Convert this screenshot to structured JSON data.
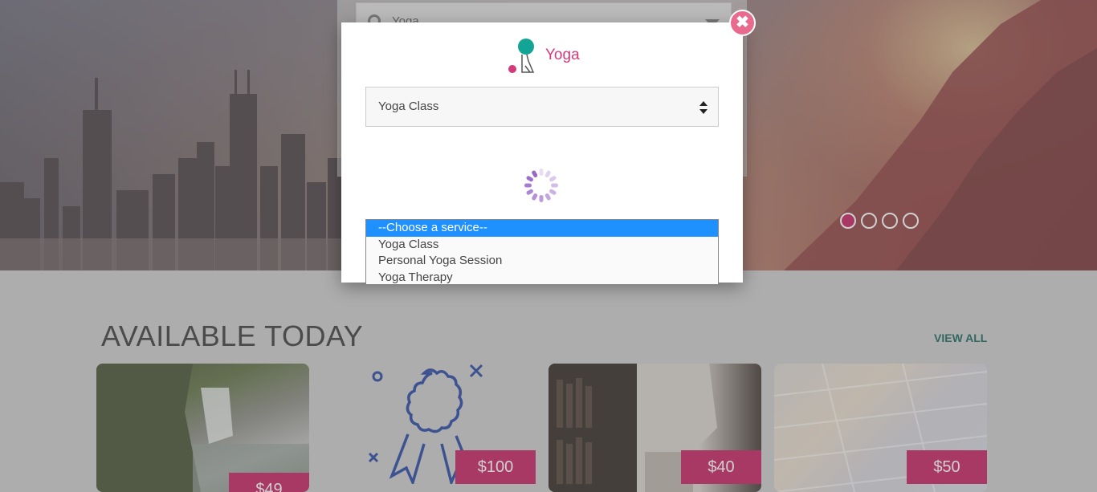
{
  "hero": {
    "search_value": "Yoga",
    "carousel_count": 4,
    "carousel_active": 1
  },
  "section": {
    "title": "AVAILABLE TODAY",
    "view_all": "VIEW ALL"
  },
  "cards": [
    {
      "price": "$49"
    },
    {
      "price": "$100"
    },
    {
      "price": "$40"
    },
    {
      "price": "$50"
    }
  ],
  "modal": {
    "title": "Yoga",
    "selected_class": "Yoga Class",
    "close_icon": "close-icon",
    "service_options": [
      "--Choose a service--",
      "Yoga Class",
      "Personal Yoga Session",
      "Yoga Therapy"
    ]
  },
  "colors": {
    "accent": "#c2185b",
    "title": "#d43a7a",
    "view_all": "#0d5f56",
    "selected_option": "#1e90ff",
    "spinner": "#8e5bc4"
  }
}
